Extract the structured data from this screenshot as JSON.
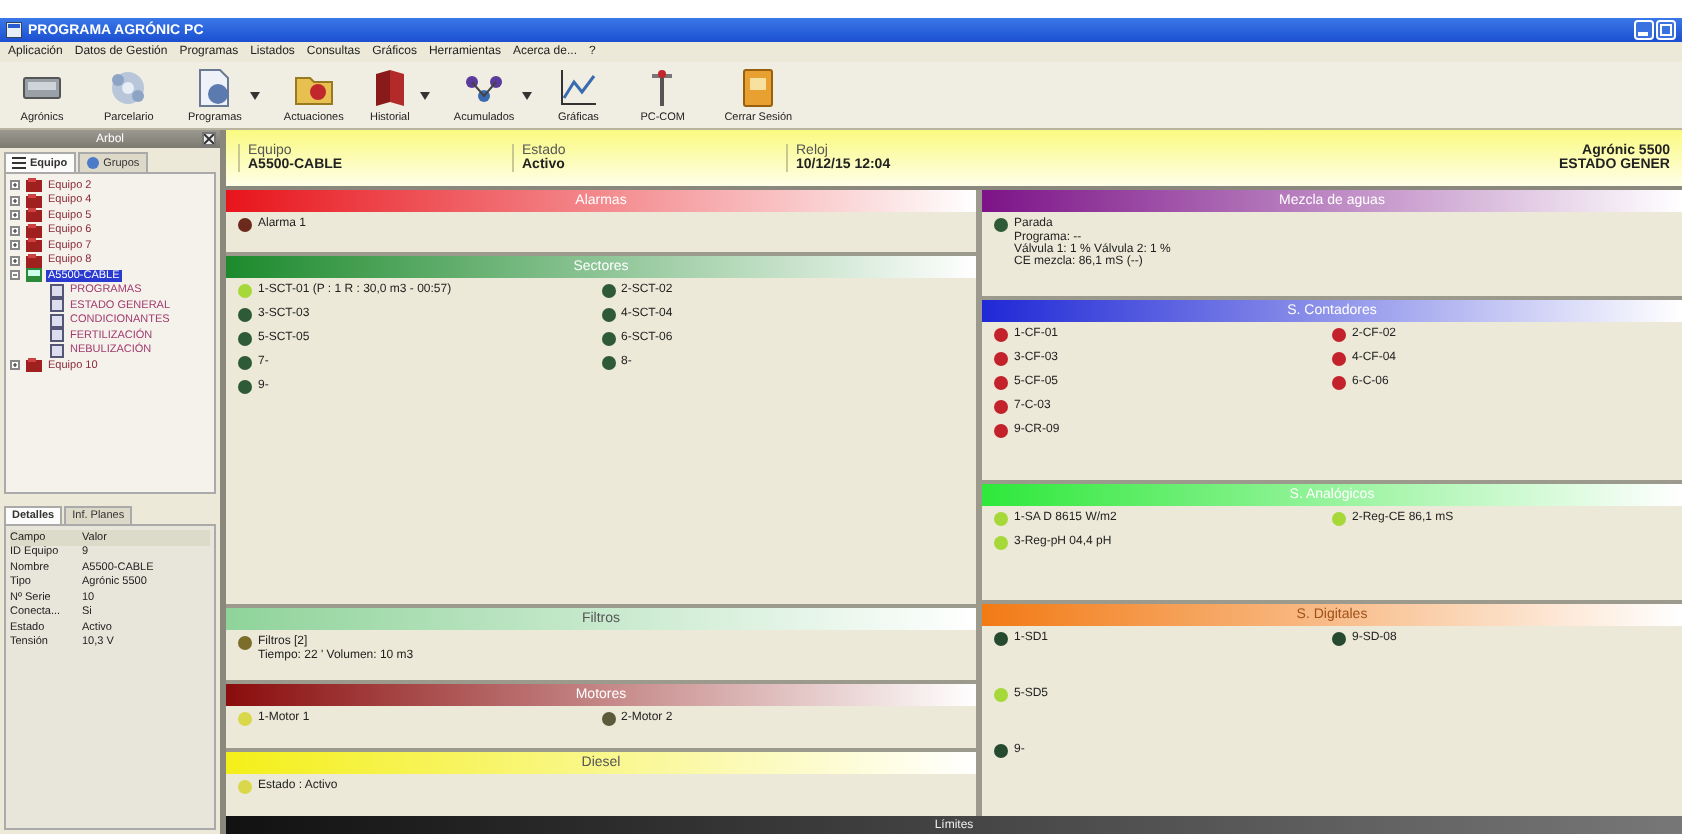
{
  "window": {
    "title": "PROGRAMA AGRÓNIC PC"
  },
  "menu": [
    "Aplicación",
    "Datos de Gestión",
    "Programas",
    "Listados",
    "Consultas",
    "Gráficos",
    "Herramientas",
    "Acerca de...",
    "?"
  ],
  "toolbar": [
    {
      "label": "Agrónics",
      "dropdown": false
    },
    {
      "label": "Parcelario",
      "dropdown": false
    },
    {
      "label": "Programas",
      "dropdown": true
    },
    {
      "label": "Actuaciones",
      "dropdown": false
    },
    {
      "label": "Historial",
      "dropdown": true
    },
    {
      "label": "Acumulados",
      "dropdown": true
    },
    {
      "label": "Gráficas",
      "dropdown": false
    },
    {
      "label": "PC-COM",
      "dropdown": false
    },
    {
      "label": "Cerrar Sesión",
      "dropdown": false
    }
  ],
  "sidebar": {
    "title": "Arbol",
    "tabs": [
      {
        "label": "Equipo",
        "selected": true
      },
      {
        "label": "Grupos",
        "selected": false
      }
    ],
    "tree": [
      {
        "label": "Equipo 2",
        "expanded": false,
        "selected": false
      },
      {
        "label": "Equipo 4",
        "expanded": false,
        "selected": false
      },
      {
        "label": "Equipo 5",
        "expanded": false,
        "selected": false
      },
      {
        "label": "Equipo 6",
        "expanded": false,
        "selected": false
      },
      {
        "label": "Equipo 7",
        "expanded": false,
        "selected": false
      },
      {
        "label": "Equipo 8",
        "expanded": false,
        "selected": false
      },
      {
        "label": "A5500-CABLE",
        "expanded": true,
        "selected": true,
        "children": [
          {
            "label": "PROGRAMAS",
            "selected": false
          },
          {
            "label": "ESTADO GENERAL",
            "selected": false
          },
          {
            "label": "CONDICIONANTES",
            "selected": false
          },
          {
            "label": "FERTILIZACIÓN",
            "selected": false
          },
          {
            "label": "NEBULIZACIÓN",
            "selected": false
          }
        ]
      },
      {
        "label": "Equipo 10",
        "expanded": false,
        "selected": false
      }
    ],
    "detail_tabs": [
      {
        "label": "Detalles",
        "selected": true
      },
      {
        "label": "Inf. Planes",
        "selected": false
      }
    ],
    "details": {
      "columns": [
        "Campo",
        "Valor"
      ],
      "rows": [
        [
          "ID Equipo",
          "9"
        ],
        [
          "Nombre",
          "A5500-CABLE"
        ],
        [
          "Tipo",
          "Agrónic 5500"
        ],
        [
          "Nº Serie",
          "10"
        ],
        [
          "Conecta...",
          "Si"
        ],
        [
          "Estado",
          "Activo"
        ],
        [
          "Tensión",
          "10,3 V"
        ]
      ]
    }
  },
  "header": {
    "fields": [
      {
        "label": "Equipo",
        "value": "A5500-CABLE"
      },
      {
        "label": "Estado",
        "value": "Activo"
      },
      {
        "label": "Reloj",
        "value": "10/12/15 12:04"
      }
    ],
    "model": "Agrónic 5500",
    "view": "ESTADO GENER"
  },
  "left_panels": [
    {
      "title": "Alarmas",
      "color": "#e8141b",
      "items": [
        {
          "label": "Alarma 1",
          "color": "#6b2a1c"
        }
      ]
    },
    {
      "title": "Sectores",
      "color": "#1c8a2c",
      "items": [
        {
          "label": "1-SCT-01 (P : 1 R : 30,0 m3 - 00:57)",
          "color": "#a6d83a"
        },
        {
          "label": "3-SCT-03",
          "color": "#2f5a38"
        },
        {
          "label": "5-SCT-05",
          "color": "#2f5a38"
        },
        {
          "label": "7-",
          "color": "#2f5a38"
        },
        {
          "label": "9-",
          "color": "#2f5a38"
        },
        {
          "label": "2-SCT-02",
          "color": "#2f5a38"
        },
        {
          "label": "4-SCT-04",
          "color": "#2f5a38"
        },
        {
          "label": "6-SCT-06",
          "color": "#2f5a38"
        },
        {
          "label": "8-",
          "color": "#2f5a38"
        }
      ]
    },
    {
      "title": "Filtros",
      "color": "#8fd39a",
      "items": [
        {
          "label": "Filtros [2]",
          "color": "#7b6d2a"
        }
      ],
      "lines": [
        "Tiempo: 22 '     Volumen: 10 m3"
      ]
    },
    {
      "title": "Motores",
      "color": "#8a0c0c",
      "items": [
        {
          "label": "1-Motor 1",
          "color": "#d8d84a"
        },
        {
          "label": "2-Motor 2",
          "color": "#5b5a3a"
        }
      ]
    },
    {
      "title": "Diesel",
      "color": "#f4ef18",
      "items": [
        {
          "label": "Estado : Activo",
          "color": "#d8d84a"
        }
      ]
    }
  ],
  "right_panels": [
    {
      "title": "Mezcla de aguas",
      "color": "#7c1388",
      "items": [
        {
          "label": "Parada",
          "color": "#2f5a38"
        }
      ],
      "lines": [
        "Programa: --",
        "Válvula 1: 1 %   Válvula 2: 1 %",
        "CE mezcla: 86,1 mS (--)"
      ]
    },
    {
      "title": "S. Contadores",
      "color": "#1f28d6",
      "items": [
        {
          "label": "1-CF-01",
          "color": "#c3222a"
        },
        {
          "label": "3-CF-03",
          "color": "#c3222a"
        },
        {
          "label": "5-CF-05",
          "color": "#c3222a"
        },
        {
          "label": "7-C-03",
          "color": "#c3222a"
        },
        {
          "label": "9-CR-09",
          "color": "#c3222a"
        },
        {
          "label": "2-CF-02",
          "color": "#c3222a"
        },
        {
          "label": "4-CF-04",
          "color": "#c3222a"
        },
        {
          "label": "6-C-06",
          "color": "#c3222a"
        }
      ]
    },
    {
      "title": "S. Analógicos",
      "color": "#2ee83a",
      "items": [
        {
          "label": "1-SA D 8615 W/m2",
          "color": "#a6d83a"
        },
        {
          "label": "3-Reg-pH 04,4 pH",
          "color": "#a6d83a"
        },
        {
          "label": "2-Reg-CE 86,1 mS",
          "color": "#a6d83a"
        }
      ]
    },
    {
      "title": "S. Digitales",
      "color": "#f27a14",
      "items": [
        {
          "label": "1-SD1",
          "color": "#264a30"
        },
        {
          "label": "5-SD5",
          "color": "#a6d83a"
        },
        {
          "label": "9-",
          "color": "#264a30"
        },
        {
          "label": "9-SD-08",
          "color": "#264a30"
        }
      ]
    }
  ],
  "status_bar": {
    "label": "Límites"
  }
}
